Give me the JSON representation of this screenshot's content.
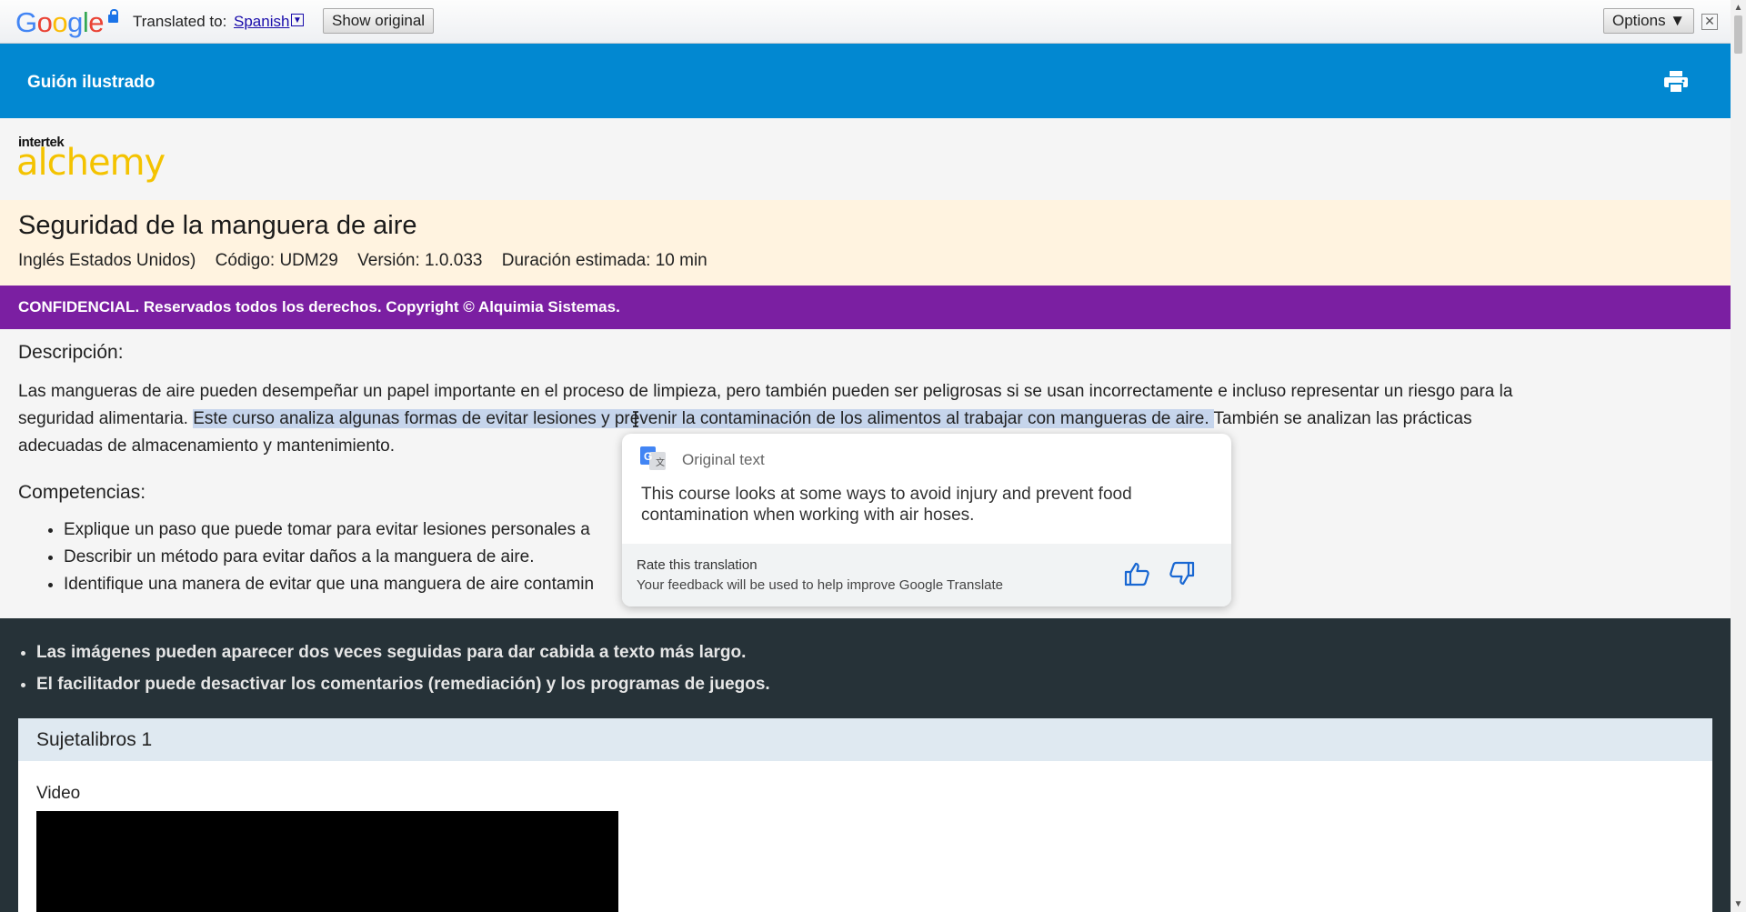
{
  "translate_bar": {
    "logo": "Google",
    "logo_colors": [
      "#4285F4",
      "#EA4335",
      "#FBBC05",
      "#4285F4",
      "#34A853",
      "#EA4335"
    ],
    "translated_label": "Translated to:",
    "language": "Spanish",
    "show_original_label": "Show original",
    "options_label": "Options ▼",
    "close_glyph": "✕"
  },
  "header": {
    "title": "Guión ilustrado",
    "print_icon": "print-icon"
  },
  "logo": {
    "small": "intertek",
    "big": "alchemy"
  },
  "course": {
    "title": "Seguridad de la manguera de aire",
    "language": "Inglés Estados Unidos)",
    "code": "Código: UDM29",
    "version": "Versión: 1.0.033",
    "duration": "Duración estimada: 10 min"
  },
  "confidential": "CONFIDENCIAL. Reservados todos los derechos. Copyright © Alquimia Sistemas.",
  "description": {
    "heading": "Descripción:",
    "text_before": "Las mangueras de aire pueden desempeñar un papel importante en el proceso de limpieza, pero también pueden ser peligrosas si se usan incorrectamente e incluso representar un riesgo para la seguridad alimentaria. ",
    "highlighted": "Este curso analiza algunas formas de evitar lesiones y prevenir la contaminación de los alimentos al trabajar con mangueras de aire. ",
    "text_after": "También se analizan las prácticas adecuadas de almacenamiento y mantenimiento."
  },
  "competencies": {
    "heading": "Competencias:",
    "items": [
      "Explique un paso que puede tomar para evitar lesiones personales a",
      "Describir un método para evitar daños a la manguera de aire.",
      "Identifique una manera de evitar que una manguera de aire contamin"
    ]
  },
  "popup": {
    "label": "Original text",
    "text": "This course looks at some ways to avoid injury and prevent food contamination when working with air hoses.",
    "rate_title": "Rate this translation",
    "rate_sub": "Your feedback will be used to help improve Google Translate"
  },
  "notes": [
    "Las imágenes pueden aparecer dos veces seguidas para dar cabida a texto más largo.",
    "El facilitador puede desactivar los comentarios (remediación) y los programas de juegos."
  ],
  "card": {
    "title": "Sujetalibros 1",
    "video_label": "Video"
  },
  "colors": {
    "header": "#0288d1",
    "course_bg": "#fff3e0",
    "confidential_bg": "#7b1fa2",
    "dark_bg": "#263238",
    "logo_yellow": "#f4c300",
    "highlight": "#c6d5ec"
  }
}
